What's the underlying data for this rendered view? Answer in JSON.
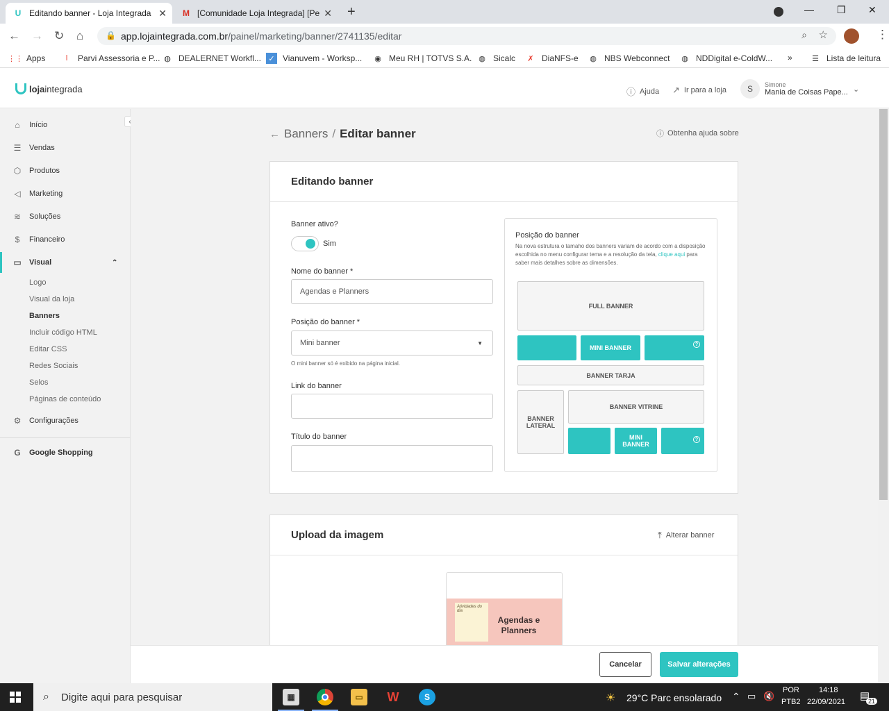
{
  "browser": {
    "tabs": [
      {
        "title": "Editando banner - Loja Integrada",
        "active": true
      },
      {
        "title": "[Comunidade Loja Integrada] [Pe",
        "active": false
      }
    ],
    "url_host": "app.lojaintegrada.com.br",
    "url_path": "/painel/marketing/banner/2741135/editar",
    "bookmarks": [
      "Apps",
      "Parvi Assessoria e P...",
      "DEALERNET Workfl...",
      "Vianuvem - Worksp...",
      "Meu RH | TOTVS S.A.",
      "Sicalc",
      "DiaNFS-e",
      "NBS Webconnect",
      "NDDigital e-ColdW...",
      "Lista de leitura"
    ]
  },
  "header": {
    "logo_bold": "loja",
    "logo_rest": "integrada",
    "help": "Ajuda",
    "goto_store": "Ir para a loja",
    "avatar_initial": "S",
    "user_small": "Simone",
    "user_store": "Mania de Coisas Pape..."
  },
  "sidebar": {
    "items": [
      {
        "label": "Início",
        "icon": "home-icon"
      },
      {
        "label": "Vendas",
        "icon": "list-icon"
      },
      {
        "label": "Produtos",
        "icon": "box-icon"
      },
      {
        "label": "Marketing",
        "icon": "megaphone-icon"
      },
      {
        "label": "Soluções",
        "icon": "layers-icon"
      },
      {
        "label": "Financeiro",
        "icon": "dollar-icon"
      },
      {
        "label": "Visual",
        "icon": "monitor-icon"
      }
    ],
    "sub": [
      "Logo",
      "Visual da loja",
      "Banners",
      "Incluir código HTML",
      "Editar CSS",
      "Redes Sociais",
      "Selos",
      "Páginas de conteúdo"
    ],
    "config": "Configurações",
    "google": "Google Shopping"
  },
  "page": {
    "breadcrumb_parent": "Banners",
    "breadcrumb_sep": "/",
    "title": "Editar banner",
    "help_link": "Obtenha ajuda sobre"
  },
  "form": {
    "card_title": "Editando banner",
    "active_label": "Banner ativo?",
    "active_value": "Sim",
    "name_label": "Nome do banner *",
    "name_value": "Agendas e Planners",
    "position_label": "Posição do banner *",
    "position_value": "Mini banner",
    "position_hint": "O mini banner só é exibido na página inicial.",
    "link_label": "Link do banner",
    "link_value": "",
    "title_label": "Título do banner",
    "title_value": ""
  },
  "position_panel": {
    "title": "Posição do banner",
    "desc_1": "Na nova estrutura o tamaho dos banners variam de acordo com a disposição escolhida no menu configurar tema e a resolução da tela,",
    "link": "clique aqui",
    "desc_2": "para saber mais detalhes sobre as dimensões.",
    "full": "FULL BANNER",
    "mini": "MINI BANNER",
    "tarja": "BANNER TARJA",
    "lateral": "BANNER LATERAL",
    "vitrine": "BANNER VITRINE",
    "mini2": "MINI BANNER",
    "accent": "#2ec4c1"
  },
  "upload": {
    "title": "Upload da imagem",
    "change": "Alterar banner",
    "preview_text": "Agendas e Planners",
    "note_title": "Atividades do dia"
  },
  "actions": {
    "cancel": "Cancelar",
    "save": "Salvar alterações"
  },
  "taskbar": {
    "search": "Digite aqui para pesquisar",
    "weather": "29°C  Parc ensolarado",
    "lang1": "POR",
    "lang2": "PTB2",
    "time": "14:18",
    "date": "22/09/2021",
    "notif": "21"
  }
}
